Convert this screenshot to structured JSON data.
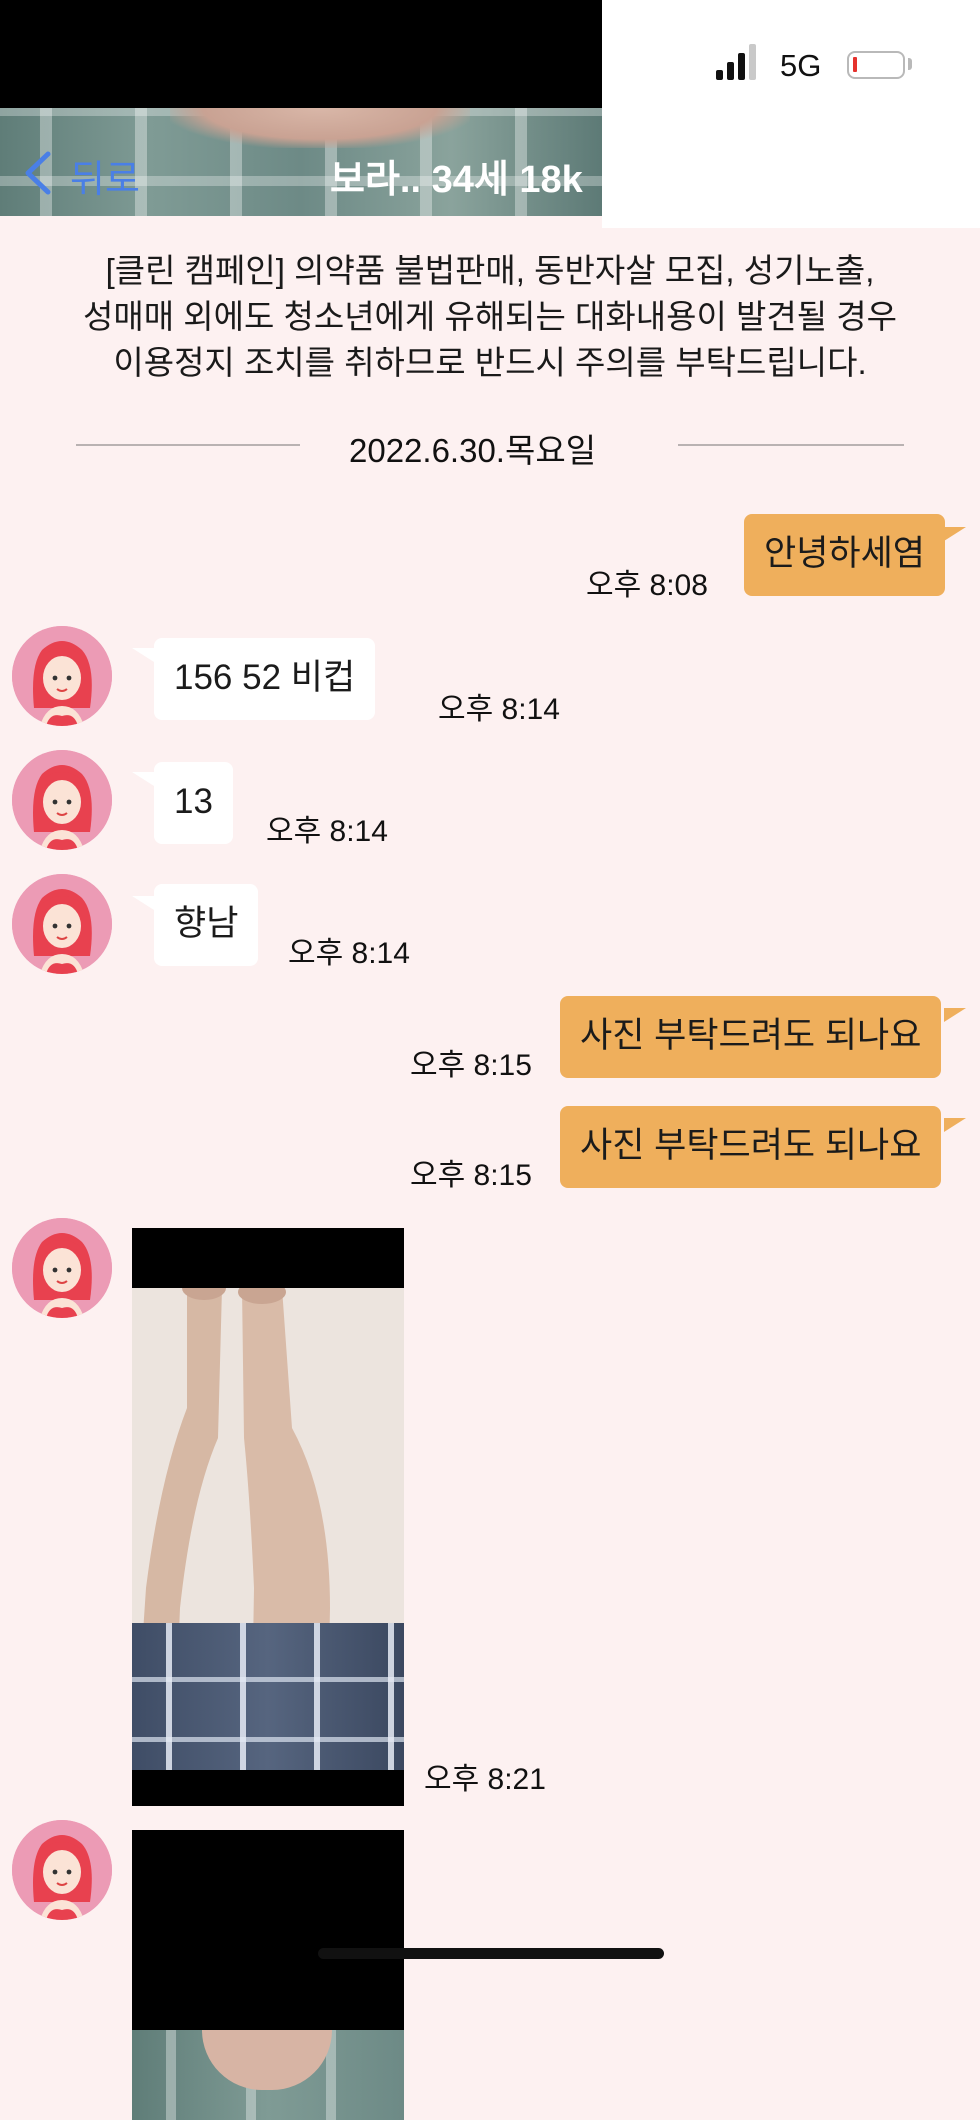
{
  "status_bar": {
    "network": "5G",
    "signal_bars": 3,
    "battery_level": 0.05
  },
  "header": {
    "back_label": "뒤로",
    "title": "보라.. 34세 18k"
  },
  "notice": {
    "lines": [
      "[클린 캠페인] 의약품 불법판매, 동반자살 모집, 성기노출,",
      "성매매 외에도 청소년에게 유해되는 대화내용이 발견될 경우",
      "이용정지 조치를 취하므로 반드시 주의를 부탁드립니다."
    ]
  },
  "date_divider": "2022.6.30.목요일",
  "messages": [
    {
      "sender": "me",
      "text": "안녕하세염",
      "time": "오후 8:08"
    },
    {
      "sender": "partner",
      "text": "156  52  비컵",
      "time": "오후 8:14"
    },
    {
      "sender": "partner",
      "text": "13",
      "time": "오후 8:14"
    },
    {
      "sender": "partner",
      "text": "향남",
      "time": "오후 8:14"
    },
    {
      "sender": "me",
      "text": "사진 부탁드려도 되나요",
      "time": "오후 8:15"
    },
    {
      "sender": "me",
      "text": "사진 부탁드려도 되나요",
      "time": "오후 8:15"
    },
    {
      "sender": "partner",
      "type": "photo",
      "time": "오후 8:21"
    },
    {
      "sender": "partner",
      "type": "photo",
      "time": ""
    }
  ],
  "colors": {
    "background": "#fdf1f1",
    "my_bubble": "#efaf5c",
    "partner_bubble": "#ffffff",
    "back_link": "#4a7fe6",
    "avatar_bg": "#ec9bb5",
    "avatar_hair": "#e8414f"
  }
}
